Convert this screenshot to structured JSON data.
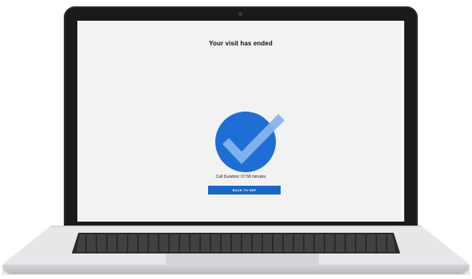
{
  "screen": {
    "title": "Your visit has ended",
    "status_icon": "checkmark-circle-icon",
    "call_duration": "Call Duration: 07:58 minutes",
    "back_button_label": "BACK TO HEP"
  },
  "colors": {
    "circle": "#1d6fd6",
    "check": "#86b4ec",
    "button": "#1766c9",
    "screen_bg": "#f2f2f2"
  }
}
